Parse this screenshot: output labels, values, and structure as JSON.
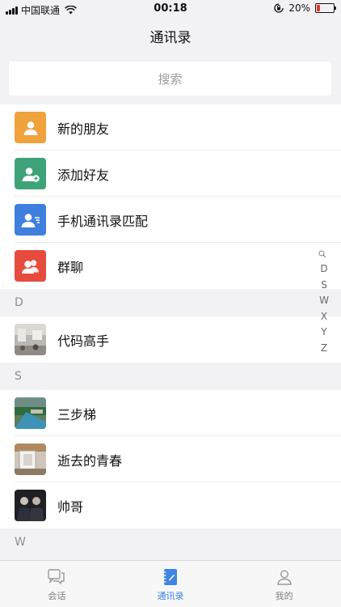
{
  "status_bar": {
    "carrier": "中国联通",
    "time": "00:18",
    "battery_text": "20%",
    "battery_level": 0.2,
    "battery_color": "#e0392b"
  },
  "nav": {
    "title": "通讯录"
  },
  "search": {
    "placeholder": "搜索"
  },
  "functions": [
    {
      "label": "新的朋友",
      "icon": "person-icon",
      "color": "#f0a23c"
    },
    {
      "label": "添加好友",
      "icon": "add-person-icon",
      "color": "#3ea378"
    },
    {
      "label": "手机通讯录匹配",
      "icon": "contacts-card-icon",
      "color": "#3f7fdd"
    },
    {
      "label": "群聊",
      "icon": "group-icon",
      "color": "#e64b3e"
    }
  ],
  "sections": [
    {
      "letter": "D",
      "contacts": [
        {
          "name": "代码高手"
        }
      ]
    },
    {
      "letter": "S",
      "contacts": [
        {
          "name": "三步梯"
        },
        {
          "name": "逝去的青春"
        },
        {
          "name": "帅哥"
        }
      ]
    },
    {
      "letter": "W",
      "contacts": []
    }
  ],
  "index_bar": {
    "letters": [
      "D",
      "S",
      "W",
      "X",
      "Y",
      "Z"
    ]
  },
  "tabs": [
    {
      "label": "会话",
      "icon": "chat-icon",
      "active": false
    },
    {
      "label": "通讯录",
      "icon": "address-book-icon",
      "active": true
    },
    {
      "label": "我的",
      "icon": "profile-icon",
      "active": false
    }
  ],
  "colors": {
    "accent": "#3f85e0",
    "background": "#f2f2f4"
  }
}
